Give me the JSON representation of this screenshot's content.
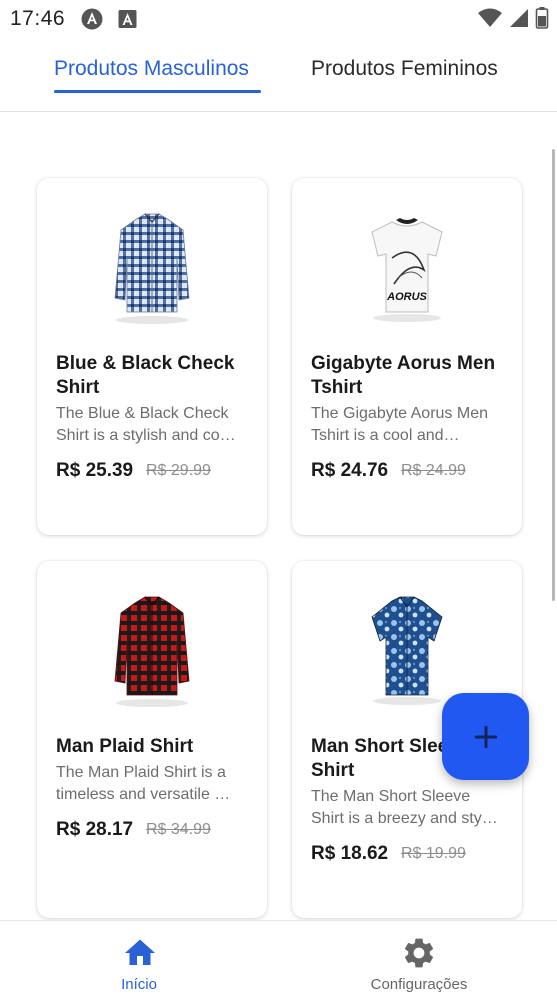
{
  "status_bar": {
    "time": "17:46",
    "icons": [
      "angular-app-icon",
      "a-app-icon",
      "wifi-icon",
      "signal-icon",
      "battery-icon"
    ]
  },
  "tabs": [
    {
      "label": "Produtos Masculinos",
      "active": true
    },
    {
      "label": "Produtos Femininos",
      "active": false
    }
  ],
  "products": [
    {
      "title": "Blue & Black Check Shirt",
      "description": "The Blue & Black Check Shirt is a stylish and co…",
      "price": "R$ 25.39",
      "old_price": "R$ 29.99",
      "image": "check-shirt-icon"
    },
    {
      "title": "Gigabyte Aorus Men Tshirt",
      "description": "The Gigabyte Aorus Men Tshirt is a cool and…",
      "price": "R$ 24.76",
      "old_price": "R$ 24.99",
      "image": "tshirt-icon",
      "image_text": "AORUS"
    },
    {
      "title": "Man Plaid Shirt",
      "description": "The Man Plaid Shirt is a timeless and versatile …",
      "price": "R$ 28.17",
      "old_price": "R$ 34.99",
      "image": "plaid-shirt-icon"
    },
    {
      "title": "Man Short Sleeve Shirt",
      "description": "The Man Short Sleeve Shirt is a breezy and sty…",
      "price": "R$ 18.62",
      "old_price": "R$ 19.99",
      "image": "floral-shirt-icon"
    }
  ],
  "fab": {
    "icon": "plus-icon"
  },
  "bottom_nav": [
    {
      "label": "Início",
      "icon": "home-icon",
      "active": true
    },
    {
      "label": "Configurações",
      "icon": "gear-icon",
      "active": false
    }
  ],
  "colors": {
    "accent": "#2a62d6",
    "fab": "#2258f2",
    "text": "#1a1a1a",
    "muted": "#6d6d6d"
  }
}
